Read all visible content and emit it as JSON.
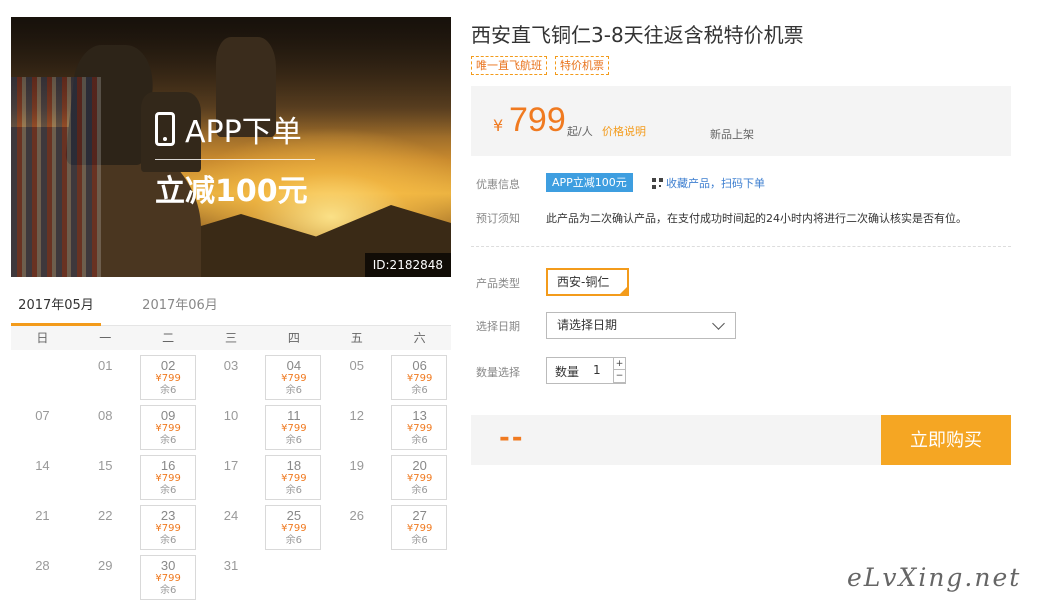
{
  "hero": {
    "promo_line1": "APP下单",
    "promo_line2": "立减100元",
    "id_badge": "ID:2182848"
  },
  "calendar": {
    "tabs": [
      "2017年05月",
      "2017年06月"
    ],
    "active_tab": 0,
    "weekdays": [
      "日",
      "一",
      "二",
      "三",
      "四",
      "五",
      "六"
    ],
    "weeks": [
      [
        null,
        {
          "d": "01"
        },
        {
          "d": "02",
          "p": "¥799",
          "s": "余6"
        },
        {
          "d": "03"
        },
        {
          "d": "04",
          "p": "¥799",
          "s": "余6"
        },
        {
          "d": "05"
        },
        {
          "d": "06",
          "p": "¥799",
          "s": "余6"
        }
      ],
      [
        {
          "d": "07"
        },
        {
          "d": "08"
        },
        {
          "d": "09",
          "p": "¥799",
          "s": "余6"
        },
        {
          "d": "10"
        },
        {
          "d": "11",
          "p": "¥799",
          "s": "余6"
        },
        {
          "d": "12"
        },
        {
          "d": "13",
          "p": "¥799",
          "s": "余6"
        }
      ],
      [
        {
          "d": "14"
        },
        {
          "d": "15"
        },
        {
          "d": "16",
          "p": "¥799",
          "s": "余6"
        },
        {
          "d": "17"
        },
        {
          "d": "18",
          "p": "¥799",
          "s": "余6"
        },
        {
          "d": "19"
        },
        {
          "d": "20",
          "p": "¥799",
          "s": "余6"
        }
      ],
      [
        {
          "d": "21"
        },
        {
          "d": "22"
        },
        {
          "d": "23",
          "p": "¥799",
          "s": "余6"
        },
        {
          "d": "24"
        },
        {
          "d": "25",
          "p": "¥799",
          "s": "余6"
        },
        {
          "d": "26"
        },
        {
          "d": "27",
          "p": "¥799",
          "s": "余6"
        }
      ],
      [
        {
          "d": "28"
        },
        {
          "d": "29"
        },
        {
          "d": "30",
          "p": "¥799",
          "s": "余6"
        },
        {
          "d": "31"
        },
        null,
        null,
        null
      ]
    ]
  },
  "product": {
    "title": "西安直飞铜仁3-8天往返含税特价机票",
    "tags": [
      "唯一直飞航班",
      "特价机票"
    ],
    "price": {
      "currency": "¥",
      "amount": "799",
      "unit": "起/人",
      "explain_link": "价格说明",
      "new_label": "新品上架"
    },
    "discount_label": "优惠信息",
    "discount_badge": "APP立减100元",
    "fav_link": "收藏产品，扫码下单",
    "notice_label": "预订须知",
    "notice_text": "此产品为二次确认产品，在支付成功时间起的24小时内将进行二次确认核实是否有位。",
    "type_label": "产品类型",
    "type_value": "西安-铜仁",
    "date_label": "选择日期",
    "date_placeholder": "请选择日期",
    "qty_label_row": "数量选择",
    "qty_label": "数量",
    "qty_value": "1",
    "stepper_plus": "+",
    "stepper_minus": "−",
    "total": "--",
    "buy_button": "立即购买"
  },
  "watermark": "eLvXing.net",
  "colors": {
    "accent_orange": "#f39b1b",
    "price_orange": "#f07a20",
    "badge_blue": "#3e9ee0",
    "buy_button": "#f5a623"
  }
}
